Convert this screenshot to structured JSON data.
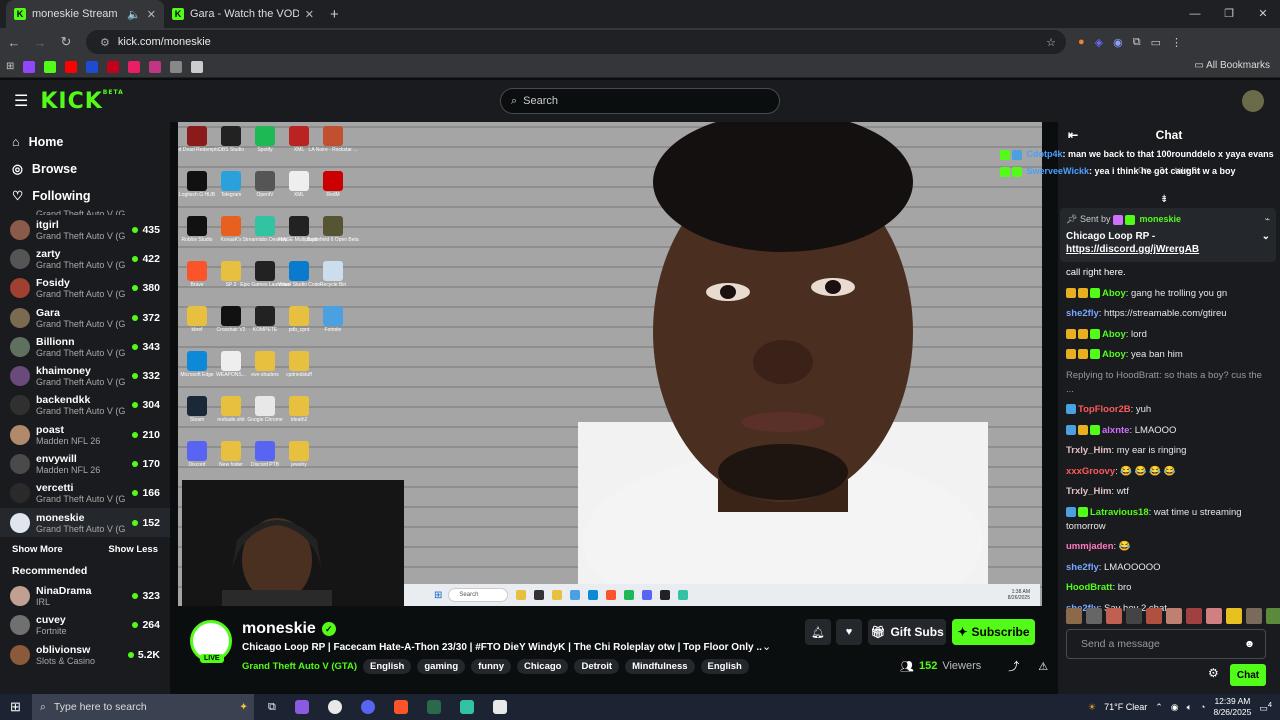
{
  "browser": {
    "tabs": [
      {
        "title": "moneskie Stream - Watch l"
      },
      {
        "title": "Gara - Watch the VOD on Kick"
      }
    ],
    "url": "kick.com/moneskie",
    "all_bookmarks": "All Bookmarks",
    "bookmark_colors": [
      "#9146ff",
      "#53fc18",
      "#ff0000",
      "#1e4bd2",
      "#c4001a",
      "#e91e63",
      "#c13584",
      "#888",
      "#cccccc"
    ]
  },
  "header": {
    "logo": "KICK",
    "beta": "BETA",
    "search_placeholder": "Search"
  },
  "sidebar": {
    "nav": [
      {
        "label": "Home",
        "icon": "home-icon"
      },
      {
        "label": "Browse",
        "icon": "compass-icon"
      },
      {
        "label": "Following",
        "icon": "heart-icon"
      }
    ],
    "partial_game": "Grand Theft Auto V (G...",
    "following": [
      {
        "name": "itgirl",
        "game": "Grand Theft Auto V (G...",
        "viewers": "435",
        "color": "#8a5a4a"
      },
      {
        "name": "zarty",
        "game": "Grand Theft Auto V (G...",
        "viewers": "422",
        "color": "#555"
      },
      {
        "name": "Fosidy",
        "game": "Grand Theft Auto V (G...",
        "viewers": "380",
        "color": "#a04030"
      },
      {
        "name": "Gara",
        "game": "Grand Theft Auto V (G...",
        "viewers": "372",
        "color": "#7a6a50"
      },
      {
        "name": "Billionn",
        "game": "Grand Theft Auto V (G...",
        "viewers": "343",
        "color": "#607060"
      },
      {
        "name": "khaimoney",
        "game": "Grand Theft Auto V (G...",
        "viewers": "332",
        "color": "#6a4a7a"
      },
      {
        "name": "backendkk",
        "game": "Grand Theft Auto V (G...",
        "viewers": "304",
        "color": "#303030"
      },
      {
        "name": "poast",
        "game": "Madden NFL 26",
        "viewers": "210",
        "color": "#b08a6a"
      },
      {
        "name": "envywill",
        "game": "Madden NFL 26",
        "viewers": "170",
        "color": "#4a4a4a"
      },
      {
        "name": "vercetti",
        "game": "Grand Theft Auto V (G...",
        "viewers": "166",
        "color": "#2a2a2a"
      },
      {
        "name": "moneskie",
        "game": "Grand Theft Auto V (G...",
        "viewers": "152",
        "color": "#dfe6ee"
      }
    ],
    "show_more": "Show More",
    "show_less": "Show Less",
    "recommended_heading": "Recommended",
    "recommended": [
      {
        "name": "NinaDrama",
        "game": "IRL",
        "viewers": "323",
        "color": "#c0a090"
      },
      {
        "name": "cuvey",
        "game": "Fortnite",
        "viewers": "264",
        "color": "#707070"
      },
      {
        "name": "oblivionsw",
        "game": "Slots & Casino",
        "viewers": "5.2K",
        "color": "#8a5a3a"
      }
    ]
  },
  "desktop_icons": [
    {
      "label": "Red Dead Redempti...",
      "color": "#8b1a1a"
    },
    {
      "label": "OBS Studio",
      "color": "#222"
    },
    {
      "label": "Spotify",
      "color": "#1db954"
    },
    {
      "label": "XML",
      "color": "#b22"
    },
    {
      "label": "LA Noire - Rockstar ...",
      "color": "#c05030"
    },
    {
      "label": "Logitech G HUB",
      "color": "#111"
    },
    {
      "label": "Telegram",
      "color": "#2aa1da"
    },
    {
      "label": "OpenIV",
      "color": "#555"
    },
    {
      "label": "XML",
      "color": "#eee"
    },
    {
      "label": "RedM",
      "color": "#c00"
    },
    {
      "label": "Roblox Studio",
      "color": "#111"
    },
    {
      "label": "KovaaK's",
      "color": "#e86020"
    },
    {
      "label": "Streamlabs Desktop",
      "color": "#31c3a2"
    },
    {
      "label": "RAGE Multiplayer",
      "color": "#222"
    },
    {
      "label": "Battlefield 6 Open Beta",
      "color": "#553"
    },
    {
      "label": "Brave",
      "color": "#fb542b"
    },
    {
      "label": "SP 2",
      "color": "#e8c040"
    },
    {
      "label": "Epic Games Launcher",
      "color": "#222"
    },
    {
      "label": "Visual Studio Code",
      "color": "#0a7acc"
    },
    {
      "label": "Recycle Bin",
      "color": "#cde"
    },
    {
      "label": "kbref",
      "color": "#e8c040"
    },
    {
      "label": "Crosshair V2",
      "color": "#111"
    },
    {
      "label": "KOMPETE",
      "color": "#222"
    },
    {
      "label": "pdb_cpnt",
      "color": "#e8c040"
    },
    {
      "label": "Fortnite",
      "color": "#4aa0e0"
    },
    {
      "label": "Microsoft Edge",
      "color": "#0c8ad8"
    },
    {
      "label": "WEAPONS...",
      "color": "#eee"
    },
    {
      "label": "eve-shaders",
      "color": "#e8c040"
    },
    {
      "label": "cpdriedstuff",
      "color": "#e8c040"
    },
    {
      "label": "",
      "color": "transparent"
    },
    {
      "label": "Steam",
      "color": "#1b2838"
    },
    {
      "label": "reshade.shit",
      "color": "#e8c040"
    },
    {
      "label": "Google Chrome",
      "color": "#e8e8e8"
    },
    {
      "label": "tdeath2",
      "color": "#e8c040"
    },
    {
      "label": "",
      "color": "transparent"
    },
    {
      "label": "Discord",
      "color": "#5865f2"
    },
    {
      "label": "New folder",
      "color": "#e8c040"
    },
    {
      "label": "Discord PTB",
      "color": "#5865f2"
    },
    {
      "label": "jewelry",
      "color": "#e8c040"
    },
    {
      "label": "",
      "color": "transparent"
    }
  ],
  "stream_taskbar": {
    "search": "Search",
    "time": "1:38 AM",
    "date": "8/26/2025"
  },
  "stream": {
    "username": "moneskie",
    "live_label": "LIVE",
    "title": "Chicago Loop RP | Facecam Hate-A-Thon 23/30 | #FTO DieY WindyK  |  The Chi Roleplay otw | Top Floor Only ...",
    "category": "Grand Theft Auto V (GTA)",
    "tags": [
      "English",
      "gaming",
      "funny",
      "Chicago",
      "Detroit",
      "Mindfulness",
      "English"
    ],
    "gift_label": "Gift Subs",
    "subscribe_label": "Subscribe",
    "viewers": "152",
    "viewers_label": "Viewers"
  },
  "chat": {
    "heading": "Chat",
    "overlay": [
      {
        "user": "Cdotp4k",
        "text": ": man we back to that 100rounddelo x yaya evans"
      },
      {
        "user": "SwerveeWickk",
        "text": ": yea i think he got caught w a boy"
      }
    ],
    "overlay_partial": "Cm... 3 ... take 3s",
    "pinned": {
      "sent_by": "Sent by",
      "sender": "moneskie",
      "text": "Chicago Loop RP - ",
      "link": "https://discord.gg/jWrergAB"
    },
    "messages": [
      {
        "user": "",
        "text": "call right here.",
        "color": "#fff",
        "badges": []
      },
      {
        "user": "Aboy",
        "text": ": gang he trolling you gn",
        "color": "#53fc18",
        "badges": [
          "#e8b020",
          "#e8b020",
          "#53fc18"
        ]
      },
      {
        "user": "she2fly",
        "text": ": https://streamable.com/gtireu",
        "color": "#7aa7ff",
        "badges": []
      },
      {
        "user": "Aboy",
        "text": ": lord",
        "color": "#53fc18",
        "badges": [
          "#e8b020",
          "#e8b020",
          "#53fc18"
        ]
      },
      {
        "user": "Aboy",
        "text": ": yea ban him",
        "color": "#53fc18",
        "badges": [
          "#e8b020",
          "#e8b020",
          "#53fc18"
        ]
      },
      {
        "user": "",
        "text": "Replying to HoodBratt: so thats a boy? cus the ...",
        "color": "#999",
        "badges": []
      },
      {
        "user": "TopFloor2B",
        "text": ": yuh",
        "color": "#ff5a5a",
        "badges": [
          "#4aa0e0"
        ]
      },
      {
        "user": "alxnte",
        "text": ": LMAOOO",
        "color": "#d070ff",
        "badges": [
          "#4aa0e0",
          "#e8b020",
          "#53fc18"
        ]
      },
      {
        "user": "Trxly_Him",
        "text": ": my ear is ringing",
        "color": "#e0c0c0",
        "badges": []
      },
      {
        "user": "xxxGroovy",
        "text": ": 😂 😂 😂 😂",
        "color": "#ff5a5a",
        "badges": []
      },
      {
        "user": "Trxly_Him",
        "text": ": wtf",
        "color": "#e0c0c0",
        "badges": []
      },
      {
        "user": "Latravious18",
        "text": ": wat time u streaming tomorrow",
        "color": "#53fc18",
        "badges": [
          "#4aa0e0",
          "#53fc18"
        ]
      },
      {
        "user": "ummjaden",
        "text": ": 😂",
        "color": "#ff7ac0",
        "badges": []
      },
      {
        "user": "she2fly",
        "text": ": LMAOOOOO",
        "color": "#7aa7ff",
        "badges": []
      },
      {
        "user": "HoodBratt",
        "text": ": bro",
        "color": "#53fc18",
        "badges": []
      },
      {
        "user": "she2fly",
        "text": ": Say hey 2 chat.",
        "color": "#7aa7ff",
        "badges": []
      }
    ],
    "send_placeholder": "Send a message",
    "chat_button": "Chat"
  },
  "taskbar": {
    "search_placeholder": "Type here to search",
    "weather": "71°F  Clear",
    "time": "12:39 AM",
    "date": "8/26/2025",
    "notifications": "4"
  }
}
